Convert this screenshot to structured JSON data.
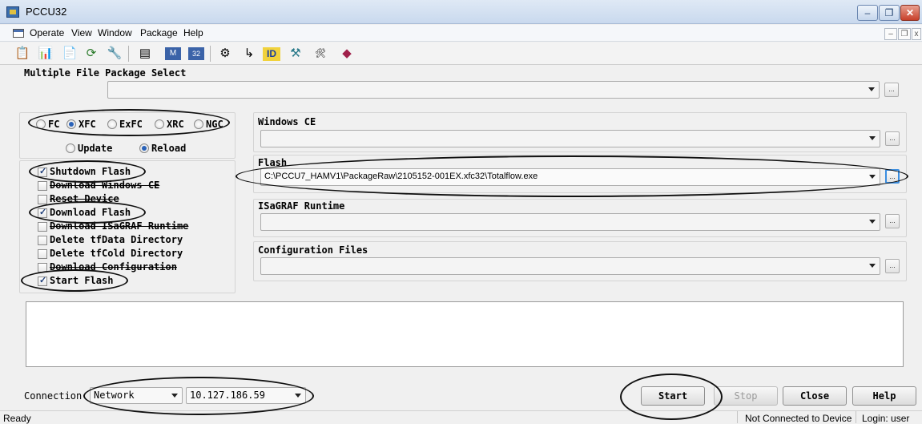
{
  "window": {
    "title": "PCCU32",
    "minimize": "–",
    "restore": "❐",
    "close": "✕"
  },
  "menu": {
    "items": [
      "Operate",
      "View",
      "Window",
      "Package",
      "Help"
    ],
    "mdi_minimize": "–",
    "mdi_restore": "❐",
    "mdi_close": "x"
  },
  "toolbar": {
    "icons": [
      "entry-icon",
      "collect-icon",
      "calibrate-icon",
      "refresh-icon",
      "mb-icon",
      "window-icon",
      "mb-registers-icon",
      "32bit-registers-icon",
      "settings-icon",
      "export-icon",
      "id-icon",
      "tools-icon",
      "setup-icon",
      "help-icon"
    ]
  },
  "package_select": {
    "label": "Multiple File Package Select",
    "value": ""
  },
  "device_types": {
    "options": [
      "FC",
      "XFC",
      "ExFC",
      "XRC",
      "NGC"
    ],
    "selected": "XFC"
  },
  "mode": {
    "options": [
      "Update",
      "Reload"
    ],
    "selected": "Reload"
  },
  "tasks": [
    {
      "label": "Shutdown Flash",
      "checked": true,
      "struck": false
    },
    {
      "label": "Download Windows CE",
      "checked": false,
      "struck": true
    },
    {
      "label": "Reset Device",
      "checked": false,
      "struck": true
    },
    {
      "label": "Download Flash",
      "checked": true,
      "struck": false
    },
    {
      "label": "Download ISaGRAF Runtime",
      "checked": false,
      "struck": true
    },
    {
      "label": "Delete tfData Directory",
      "checked": false,
      "struck": false
    },
    {
      "label": "Delete tfCold Directory",
      "checked": false,
      "struck": false
    },
    {
      "label": "Download Configuration",
      "checked": false,
      "struck": true
    },
    {
      "label": "Start Flash",
      "checked": true,
      "struck": false
    }
  ],
  "files": {
    "windows_ce": {
      "label": "Windows CE",
      "value": ""
    },
    "flash": {
      "label": "Flash",
      "value": "C:\\PCCU7_HAMV1\\PackageRaw\\2105152-001EX.xfc32\\Totalflow.exe"
    },
    "isagraf": {
      "label": "ISaGRAF Runtime",
      "value": ""
    },
    "config": {
      "label": "Configuration Files",
      "value": ""
    }
  },
  "browse_label": "...",
  "connection": {
    "label": "Connection",
    "type": "Network",
    "address": "10.127.186.59"
  },
  "buttons": {
    "start": "Start",
    "stop": "Stop",
    "close": "Close",
    "help": "Help"
  },
  "status": {
    "left": "Ready",
    "device": "Not Connected to Device",
    "login": "Login: user"
  },
  "annotation_color": "#111111"
}
